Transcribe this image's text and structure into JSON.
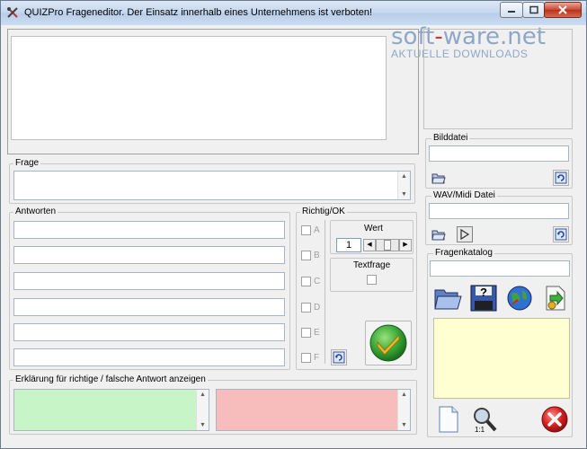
{
  "window": {
    "title": "QUIZPro Frageneditor. Der Einsatz innerhalb eines Unternehmens ist verboten!"
  },
  "watermark": {
    "brand_pre": "soft",
    "brand_mid": "ware",
    "brand_post": ".net",
    "tagline": "AKTUELLE DOWNLOADS"
  },
  "frage": {
    "label": "Frage",
    "value": ""
  },
  "antworten": {
    "label": "Antworten",
    "items": [
      "",
      "",
      "",
      "",
      "",
      ""
    ]
  },
  "richtig": {
    "label": "Richtig/OK",
    "letters": [
      "A",
      "B",
      "C",
      "D",
      "E",
      "F"
    ]
  },
  "wert": {
    "label": "Wert",
    "value": "1"
  },
  "textfrage": {
    "label": "Textfrage"
  },
  "erklaerung": {
    "label": "Erklärung für richtige / falsche Antwort anzeigen"
  },
  "bilddatei": {
    "label": "Bilddatei",
    "value": ""
  },
  "wav": {
    "label": "WAV/Midi Datei",
    "value": ""
  },
  "fragenkatalog": {
    "label": "Fragenkatalog",
    "value": ""
  },
  "colors": {
    "right_explanation": "#c8f5c8",
    "wrong_explanation": "#f7bcbc",
    "catalog_preview": "#ffffd2",
    "confirm_green": "#38a838",
    "close_red": "#d82020"
  },
  "icons": {
    "bild_open": "folder-open-icon",
    "bild_refresh": "refresh-icon",
    "wav_open": "folder-open-icon",
    "wav_play": "play-sound-icon",
    "wav_refresh": "refresh-icon",
    "kat_open": "folder-icon",
    "kat_help": "help-disk-icon",
    "kat_web": "globe-icon",
    "kat_export": "export-icon",
    "new_doc": "new-document-icon",
    "search": "search-icon",
    "close": "close-icon",
    "confirm": "checkmark-icon"
  }
}
